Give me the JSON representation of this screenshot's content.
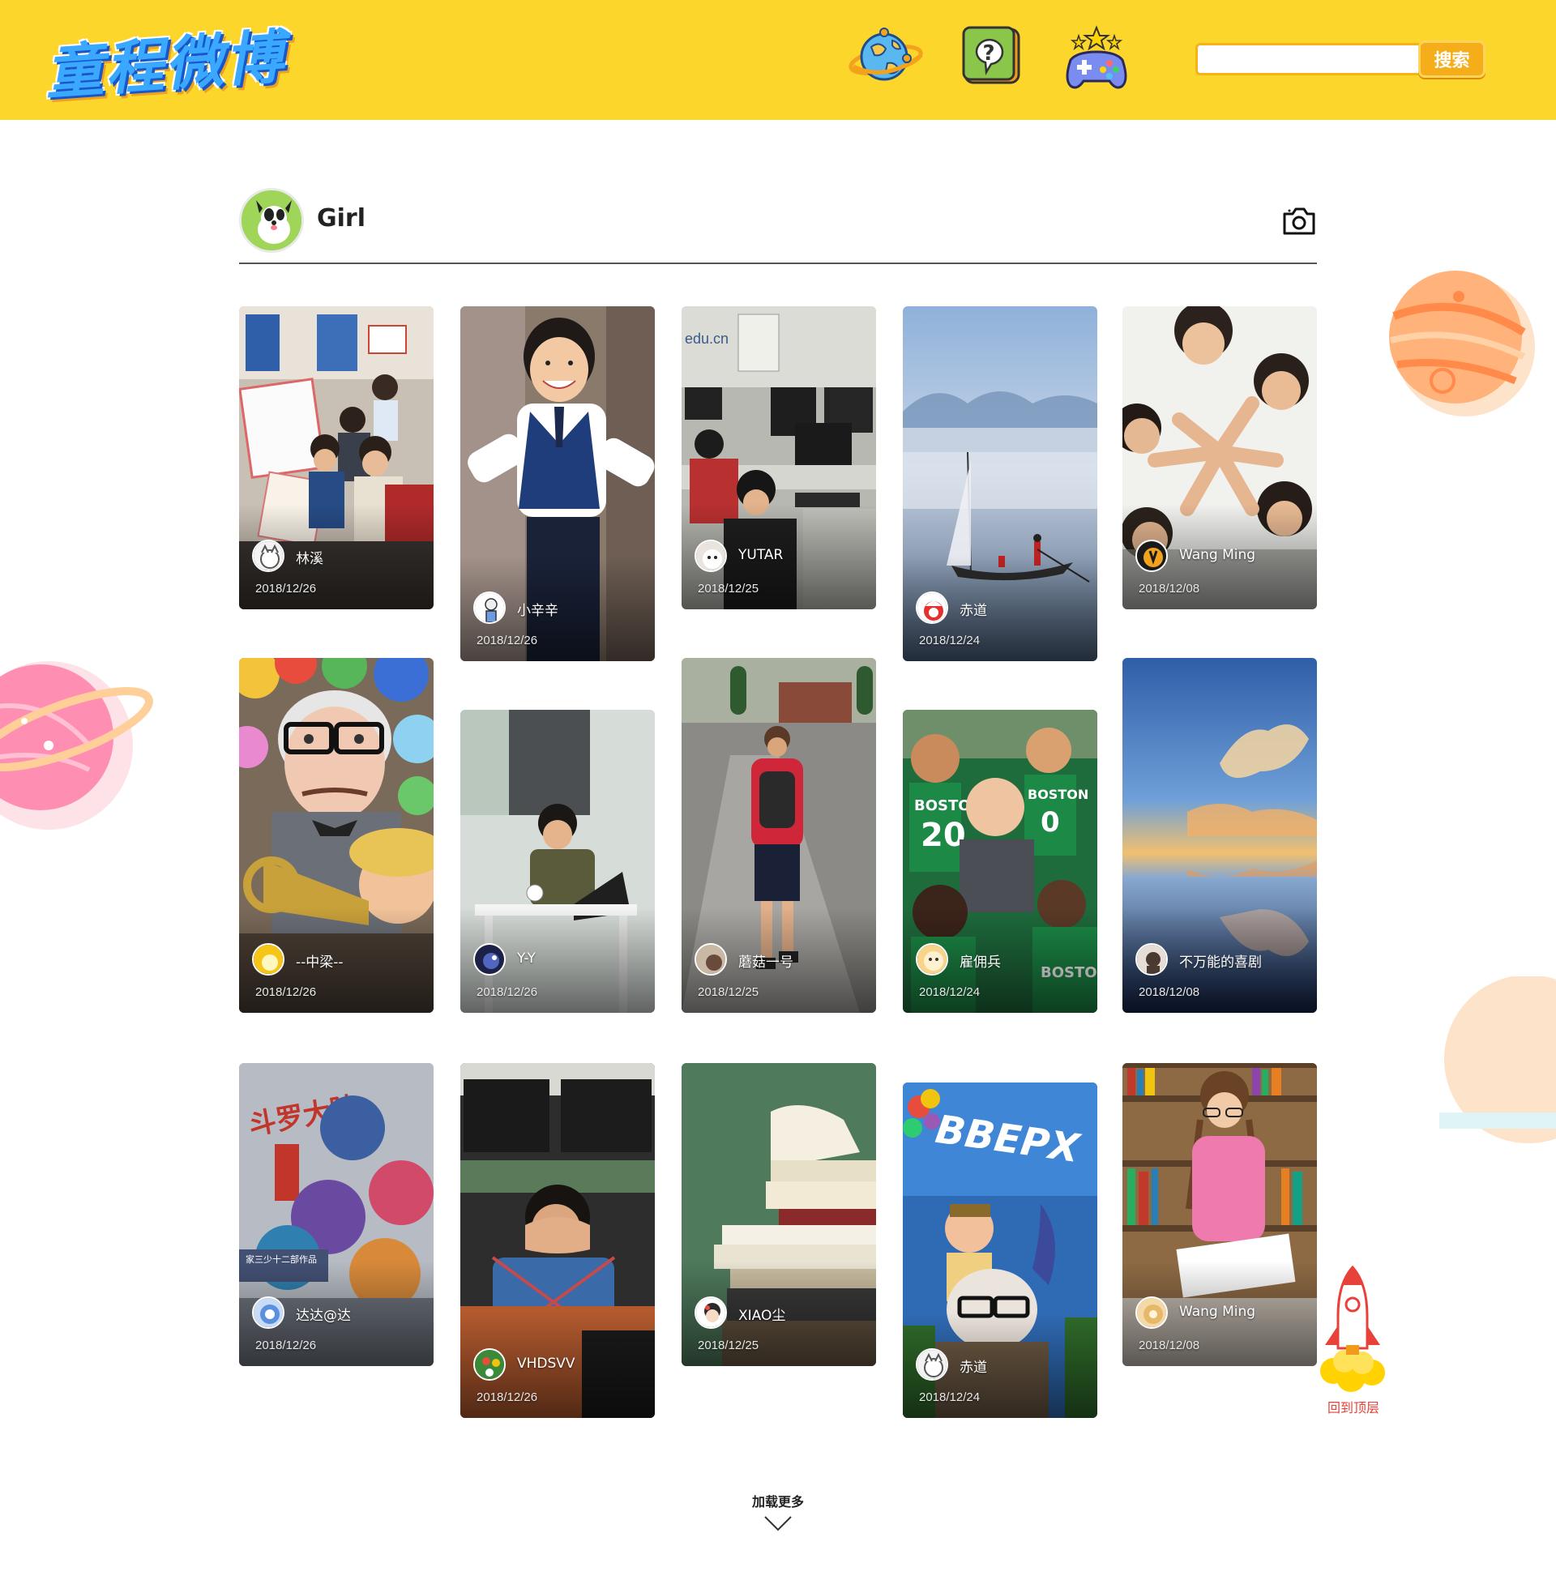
{
  "header": {
    "logo_text": "童程微博",
    "nav": [
      {
        "name": "globe",
        "icon": "globe-icon"
      },
      {
        "name": "qa",
        "icon": "question-icon"
      },
      {
        "name": "game",
        "icon": "gamepad-icon"
      }
    ],
    "search": {
      "value": "",
      "placeholder": "",
      "button_label": "搜索"
    },
    "background_color": "#fcd62a"
  },
  "profile": {
    "name": "Girl",
    "avatar_icon": "dog-avatar",
    "camera_icon": "camera-icon"
  },
  "cards": [
    {
      "user": "林溪",
      "date": "2018/12/26",
      "image": "kids-with-certificates"
    },
    {
      "user": "小辛辛",
      "date": "2018/12/26",
      "image": "boy-running-uniform"
    },
    {
      "user": "YUTAR",
      "date": "2018/12/25",
      "image": "kids-computer-lab"
    },
    {
      "user": "赤道",
      "date": "2018/12/24",
      "image": "misty-lake-boat"
    },
    {
      "user": "Wang Ming",
      "date": "2018/12/08",
      "image": "kids-hands-star"
    },
    {
      "user": "--中梁--",
      "date": "2018/12/26",
      "image": "up-carl-russell"
    },
    {
      "user": "Y-Y",
      "date": "2018/12/26",
      "image": "boy-laptop-classroom"
    },
    {
      "user": "蘑菇一号",
      "date": "2018/12/25",
      "image": "boy-backpack-walking"
    },
    {
      "user": "雇佣兵",
      "date": "2018/12/24",
      "image": "boston-celtics-players"
    },
    {
      "user": "不万能的喜剧",
      "date": "2018/12/08",
      "image": "sunset-reflection"
    },
    {
      "user": "达达@达",
      "date": "2018/12/26",
      "image": "comic-book-cover"
    },
    {
      "user": "VHDSVV",
      "date": "2018/12/26",
      "image": "boy-at-desk-computers"
    },
    {
      "user": "XIAO尘",
      "date": "2018/12/25",
      "image": "stack-of-books"
    },
    {
      "user": "赤道",
      "date": "2018/12/24",
      "image": "up-movie-poster"
    },
    {
      "user": "Wang Ming",
      "date": "2018/12/08",
      "image": "girl-reading-library"
    }
  ],
  "load_more": {
    "label": "加载更多",
    "icon": "chevron-down-icon"
  },
  "back_to_top": {
    "label": "回到顶层",
    "icon": "rocket-icon"
  },
  "colors": {
    "accent": "#f5ad1a",
    "back_to_top_text": "#e8413a"
  }
}
